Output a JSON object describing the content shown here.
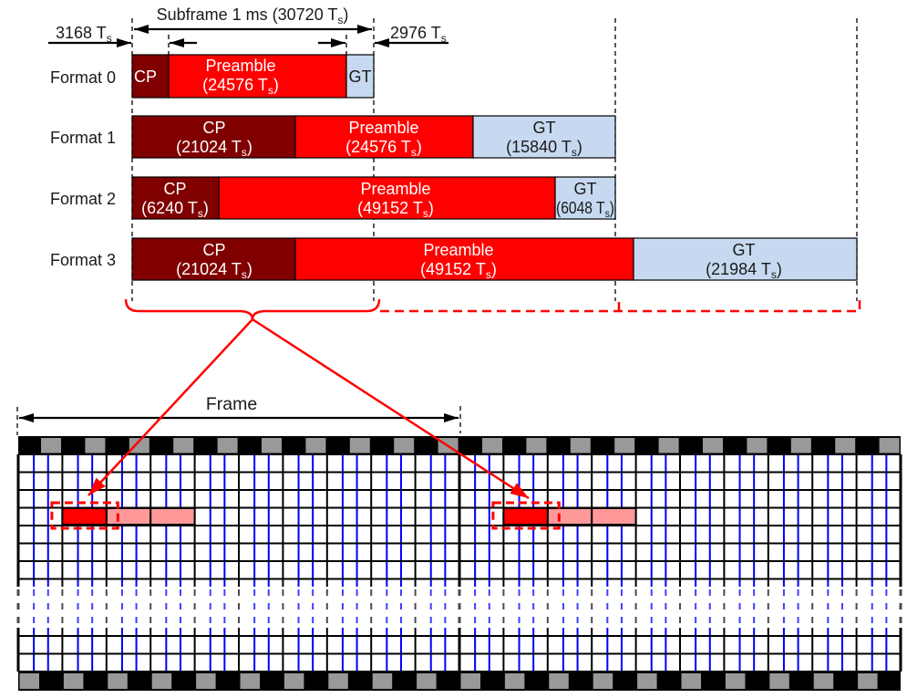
{
  "annotations": {
    "subframe": {
      "text": "Subframe 1 ms (30720 T",
      "sub": "s",
      "after": ")"
    },
    "left_offset": {
      "text": "3168 T",
      "sub": "s"
    },
    "right_offset": {
      "text": "2976 T",
      "sub": "s"
    },
    "frame_label": "Frame"
  },
  "formats": [
    {
      "label": "Format 0",
      "segments": [
        {
          "type": "cp",
          "name": "CP"
        },
        {
          "type": "preamble",
          "name": "Preamble",
          "value": {
            "text": "(24576 T",
            "sub": "s",
            "after": ")"
          }
        },
        {
          "type": "gt",
          "name": "GT"
        }
      ]
    },
    {
      "label": "Format 1",
      "segments": [
        {
          "type": "cp",
          "name": "CP",
          "value": {
            "text": "(21024 T",
            "sub": "s",
            "after": ")"
          }
        },
        {
          "type": "preamble",
          "name": "Preamble",
          "value": {
            "text": "(24576 T",
            "sub": "s",
            "after": ")"
          }
        },
        {
          "type": "gt",
          "name": "GT",
          "value": {
            "text": "(15840 T",
            "sub": "s",
            "after": ")"
          }
        }
      ]
    },
    {
      "label": "Format 2",
      "segments": [
        {
          "type": "cp",
          "name": "CP",
          "value": {
            "text": "(6240 T",
            "sub": "s",
            "after": ")"
          }
        },
        {
          "type": "preamble",
          "name": "Preamble",
          "value": {
            "text": "(49152 T",
            "sub": "s",
            "after": ")"
          }
        },
        {
          "type": "gt",
          "name": "GT",
          "value": {
            "text": "(6048 T",
            "sub": "s",
            "after": ")"
          }
        }
      ]
    },
    {
      "label": "Format 3",
      "segments": [
        {
          "type": "cp",
          "name": "CP",
          "value": {
            "text": "(21024 T",
            "sub": "s",
            "after": ")"
          }
        },
        {
          "type": "preamble",
          "name": "Preamble",
          "value": {
            "text": "(49152 T",
            "sub": "s",
            "after": ")"
          }
        },
        {
          "type": "gt",
          "name": "GT",
          "value": {
            "text": "(21984 T",
            "sub": "s",
            "after": ")"
          }
        }
      ]
    }
  ],
  "resource_grid": {
    "frames": 2,
    "subframes_per_frame": 10,
    "subcarrier_lines_per_subframe": 2,
    "prach": [
      {
        "frame": 0,
        "subframe": 1,
        "resource_row": 3,
        "extension_subframes": 2
      },
      {
        "frame": 1,
        "subframe": 1,
        "resource_row": 3,
        "extension_subframes": 2
      }
    ]
  },
  "colors": {
    "cp": "#800000",
    "preamble": "#ff0000",
    "gt": "#c6d9f0",
    "highlight": "#ff0000",
    "prach_primary": "#ff0000",
    "prach_extension": "#ff9999",
    "subcarrier_line": "#0000ff",
    "reference_dark": "#000000",
    "reference_gray": "#999999"
  }
}
